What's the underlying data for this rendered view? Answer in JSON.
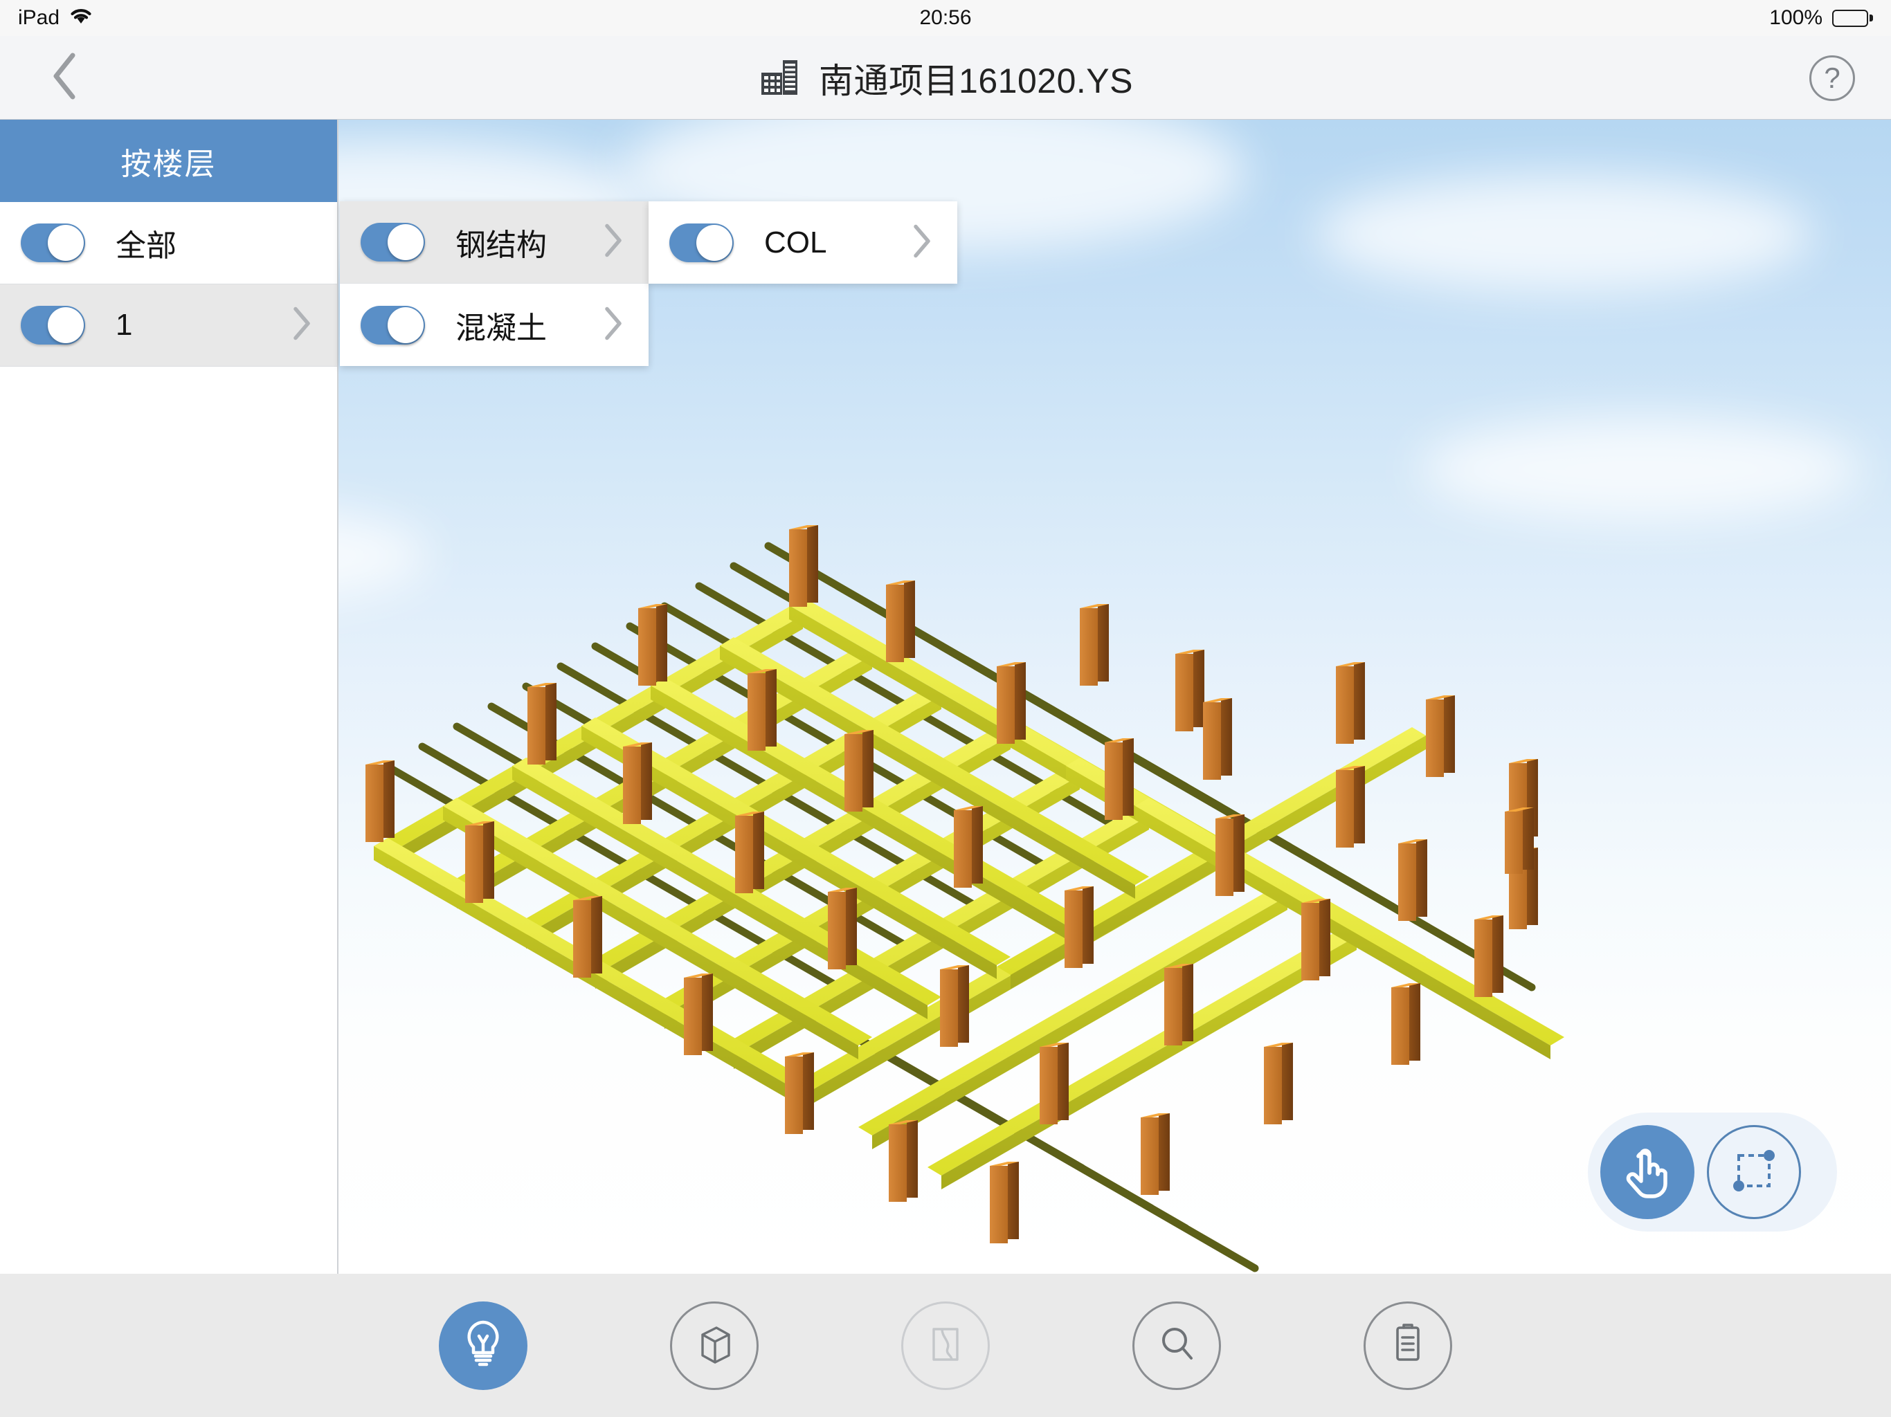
{
  "status_bar": {
    "device": "iPad",
    "wifi_icon": "wifi-icon",
    "time": "20:56",
    "battery_percent": "100%",
    "battery_icon": "battery-full-icon"
  },
  "nav_bar": {
    "back_icon": "chevron-left-icon",
    "building_icon": "building-icon",
    "title": "南通项目161020.YS",
    "help_label": "?",
    "help_icon": "question-mark-icon"
  },
  "panels": {
    "floors": {
      "header": "按楼层",
      "rows": [
        {
          "label": "全部",
          "toggle_on": true,
          "has_chevron": false,
          "selected": false
        },
        {
          "label": "1",
          "toggle_on": true,
          "has_chevron": true,
          "selected": true
        }
      ]
    },
    "materials": {
      "rows": [
        {
          "label": "钢结构",
          "toggle_on": true,
          "has_chevron": true,
          "selected": true
        },
        {
          "label": "混凝土",
          "toggle_on": true,
          "has_chevron": true,
          "selected": false
        }
      ]
    },
    "members": {
      "rows": [
        {
          "label": "COL",
          "toggle_on": true,
          "has_chevron": true,
          "selected": false
        }
      ]
    }
  },
  "tool_pill": {
    "buttons": [
      {
        "icon": "tap-hand-icon",
        "active": true
      },
      {
        "icon": "rectangle-select-icon",
        "active": false
      }
    ]
  },
  "toolbar": {
    "items": [
      {
        "icon": "lightbulb-icon",
        "state": "active"
      },
      {
        "icon": "cube-3d-icon",
        "state": "idle"
      },
      {
        "icon": "section-plan-icon",
        "state": "disabled"
      },
      {
        "icon": "magnifier-icon",
        "state": "idle"
      },
      {
        "icon": "clipboard-icon",
        "state": "idle"
      }
    ]
  },
  "viewport": {
    "scene_name": "isometric-structural-frame",
    "beam_color_main": "#e6e83a",
    "beam_color_secondary": "#5c5f18",
    "column_color": "#c8792e",
    "joint_color": "#f5a73c",
    "sky_top_color": "#b6d7f2",
    "sky_bottom_color": "#ffffff"
  }
}
